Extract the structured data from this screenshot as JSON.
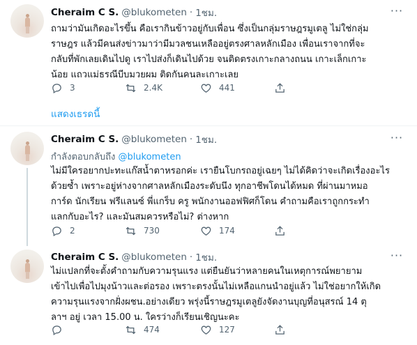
{
  "tweets": [
    {
      "name": "Cheraim C S.",
      "handle": "@blukometen",
      "dot": "·",
      "time": "1ชม.",
      "text": "ถามว่ามันเกิดอะไรขึ้น คือเรากินข้าวอยู่กับเพื่อน ซึ่งเป็นกลุ่มราษฎรมูเตลู ไม่ใช่กลุ่ม\nราษฎร แล้วมีคนส่งข่าวมาว่ามีมวลชนเหลืออยู่ตรงศาลหลักเมือง เพื่อนเราจากที่จะ\nกลับที่พักเลยเดินไปดู เราไปส่งก็เดินไปด้วย จนติดตรงเกาะกลางถนน เกาะเล็กเกาะ\nน้อย แถวแม่ธรณีบีบมวยผม ติดกันคนละเกาะเลย",
      "replies": "3",
      "retweets": "2.4K",
      "likes": "441"
    },
    {
      "name": "Cheraim C S.",
      "handle": "@blukometen",
      "dot": "·",
      "time": "1ชม.",
      "reply_prefix": "กำลังตอบกลับถึง",
      "reply_mention": "@blukometen",
      "text": "ไม่มีใครอยากปะทะแก๊สน้ำตาหรอกค่ะ เรายืนโบกรถอยู่เฉยๆ ไม่ได้คิดว่าจะเกิดเรื่องอะไร\nด้วยซ้ำ เพราะอยู่ห่างจากศาลหลักเมืองระดับนึง ทุกอาชีพโดนได้หมด ที่ผ่านมาหมอ\nการ์ด นักเรียน ฟรีแลนซ์ พี่แกร็บ ครู พนักงานออฟฟิศก็โดน คำถามคือเราถูกกระทำ\nแลกกับอะไร? และมันสมควรหรือไม่? ต่างหาก",
      "replies": "2",
      "retweets": "730",
      "likes": "174"
    },
    {
      "name": "Cheraim C S.",
      "handle": "@blukometen",
      "dot": "·",
      "time": "1ชม.",
      "text": "ไม่แปลกที่จะตั้งคำถามกับความรุนแรง แต่ยืนยันว่าหลายคนในเหตุการณ์พยายาม\nเข้าไปเพื่อไปมุงน้าวและต่อรอง เพราะตรงนั้นไม่เหลือแกนนำอยู่แล้ว ไม่ใช่อยากให้เกิด\nความรุนแรงจากฝั่งผชน.อย่างเดียว พรุ่งนี้ราษฎรมูเตลูยังจัดงานบุญที่อนุสรณ์ 14 ตุ\nลาฯ อยู่ เวลา 15.00 น. ใครว่างก็เรียนเชิญนะคะ",
      "replies": "",
      "retweets": "474",
      "likes": "127"
    }
  ],
  "show_thread_label": "แสดงเธรดนี้",
  "icons": {
    "reply": "reply-icon",
    "retweet": "retweet-icon",
    "like": "like-icon",
    "share": "share-icon",
    "more": "more-icon"
  },
  "colors": {
    "link": "#1d9bf0",
    "secondary_text": "#536471",
    "thread_line": "#cfd9de"
  }
}
